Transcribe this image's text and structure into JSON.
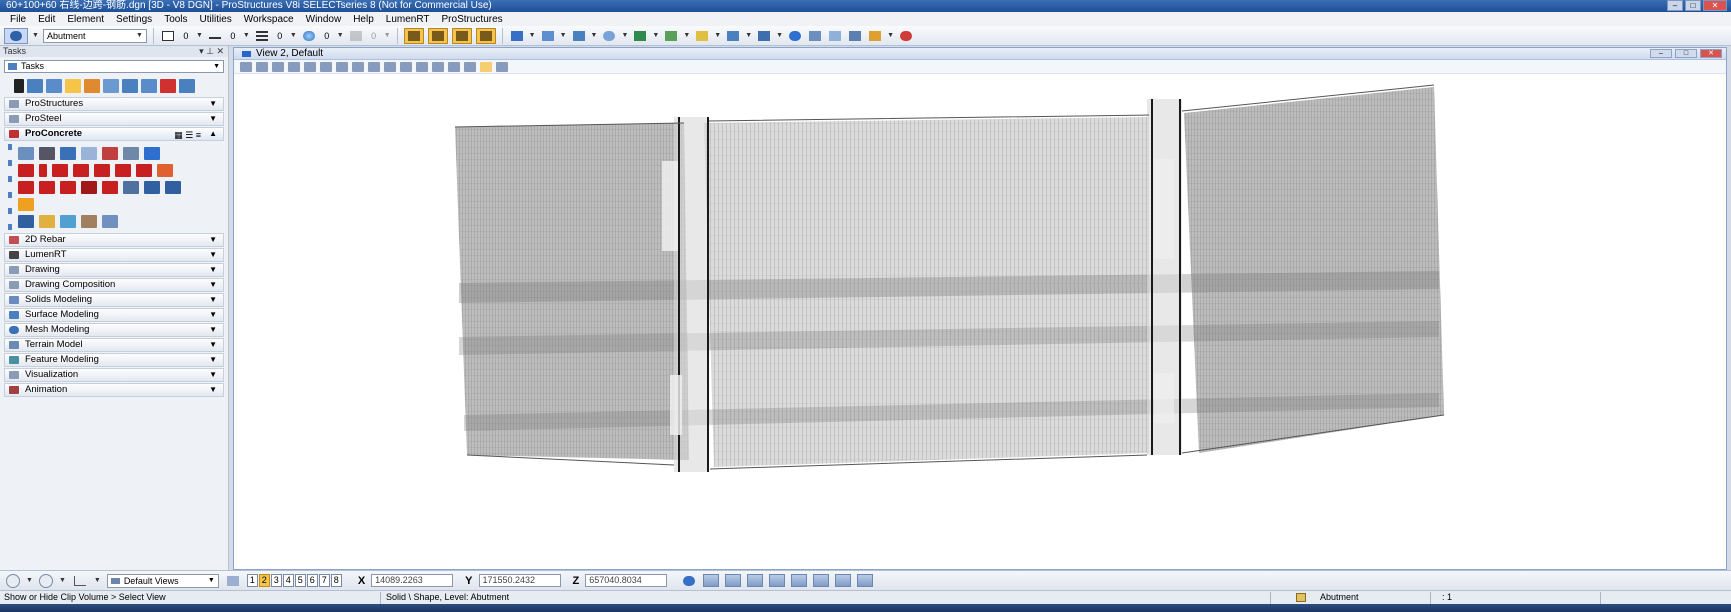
{
  "window": {
    "title": "60+100+60 右线-边跨-钢筋.dgn [3D - V8 DGN] - ProStructures V8i SELECTseries 8 (Not for Commercial Use)",
    "buttons": {
      "minimize": "–",
      "maximize": "□",
      "close": "✕"
    }
  },
  "menu": [
    "File",
    "Edit",
    "Element",
    "Settings",
    "Tools",
    "Utilities",
    "Workspace",
    "Window",
    "Help",
    "LumenRT",
    "ProStructures"
  ],
  "toolbar": {
    "level_value": "Abutment",
    "color_value": "0",
    "style_value": "0",
    "weight_value": "0",
    "transparency_value": "0",
    "priority_value": "0"
  },
  "tasks": {
    "header": "Tasks",
    "combo_value": "Tasks",
    "groups": [
      {
        "label": "ProStructures",
        "icon": "prostructures-icon"
      },
      {
        "label": "ProSteel",
        "icon": "prosteel-icon"
      },
      {
        "label": "ProConcrete",
        "icon": "proconcrete-icon",
        "open": true
      },
      {
        "label": "2D Rebar",
        "icon": "rebar-icon"
      },
      {
        "label": "LumenRT",
        "icon": "lumenrt-icon"
      },
      {
        "label": "Drawing",
        "icon": "drawing-icon"
      },
      {
        "label": "Drawing Composition",
        "icon": "composition-icon"
      },
      {
        "label": "Solids Modeling",
        "icon": "solids-icon"
      },
      {
        "label": "Surface Modeling",
        "icon": "surface-icon"
      },
      {
        "label": "Mesh Modeling",
        "icon": "mesh-icon"
      },
      {
        "label": "Terrain Model",
        "icon": "terrain-icon"
      },
      {
        "label": "Feature Modeling",
        "icon": "feature-icon"
      },
      {
        "label": "Visualization",
        "icon": "visualization-icon"
      },
      {
        "label": "Animation",
        "icon": "animation-icon"
      }
    ]
  },
  "view": {
    "title": "View 2, Default"
  },
  "bottom": {
    "views_combo": "Default Views",
    "view_numbers": [
      "1",
      "2",
      "3",
      "4",
      "5",
      "6",
      "7",
      "8"
    ],
    "active_view": "2",
    "x_label": "X",
    "x_value": "14089.2263",
    "y_label": "Y",
    "y_value": "171550.2432",
    "z_label": "Z",
    "z_value": "657040.8034"
  },
  "status": {
    "prompt": "Show or Hide Clip Volume > Select View",
    "element_info": "Solid \\ Shape, Level: Abutment",
    "active_level": "Abutment",
    "pointer": ": 1"
  },
  "colors": {
    "titlebar": "#1d4f95",
    "panel": "#eef1f6",
    "accent": "#f7c44a",
    "model_gray": "#9a9a9a",
    "model_dark": "#2a2a2a"
  }
}
